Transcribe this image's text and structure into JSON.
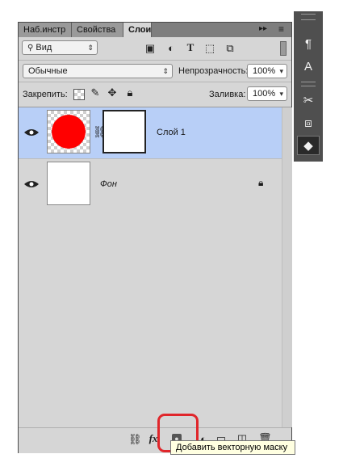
{
  "tabs": [
    {
      "label": "Наб.инстр"
    },
    {
      "label": "Свойства"
    },
    {
      "label": "Слои"
    }
  ],
  "tabbar_right": {
    "collapse": "▸▸",
    "menu": "≡"
  },
  "filter": {
    "kind": "Вид"
  },
  "blend": {
    "mode": "Обычные",
    "opacity_label": "Непрозрачность:",
    "opacity_value": "100%"
  },
  "lock": {
    "label": "Закрепить:",
    "fill_label": "Заливка:",
    "fill_value": "100%"
  },
  "layers": [
    {
      "name": "Слой 1",
      "selected": true,
      "thumb": "red-circle",
      "mask": true
    },
    {
      "name": "Фон",
      "selected": false,
      "thumb": "white",
      "locked": true
    }
  ],
  "tooltip": {
    "text": "Добавить векторную маску"
  },
  "colors": {
    "selected_row": "#b8cff7",
    "panel_bg": "#d6d6d6",
    "dock_bg": "#4f4f4f",
    "highlight": "#e0262b",
    "red_fill": "#ff0000"
  }
}
